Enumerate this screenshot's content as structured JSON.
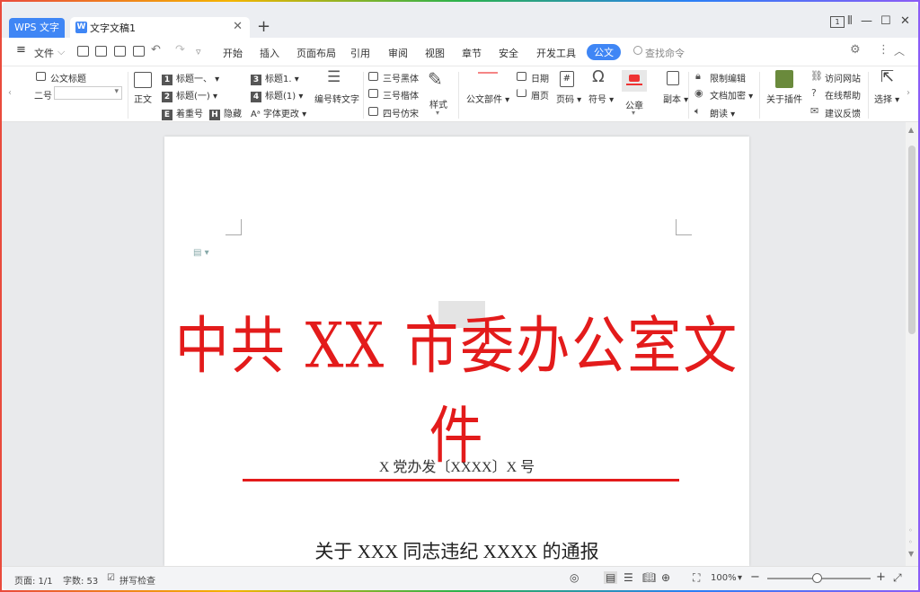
{
  "titlebar": {
    "app_tab": "WPS 文字",
    "doc_tab": "文字文稿1",
    "new_tab": "+",
    "badge": "1"
  },
  "menubar": {
    "file": "文件",
    "tabs": [
      "开始",
      "插入",
      "页面布局",
      "引用",
      "审阅",
      "视图",
      "章节",
      "安全",
      "开发工具",
      "公文"
    ],
    "active_tab": "公文",
    "search_placeholder": "查找命令"
  },
  "ribbon": {
    "official_title": "公文标题",
    "size_label": "二号",
    "body_text": "正文",
    "heading1": "标题一、",
    "heading2": "标题(一)",
    "emphasis": "着重号",
    "hide": "隐藏",
    "heading3": "标题1.",
    "heading4": "标题(1)",
    "font_change": "字体更改",
    "num_to_text": "编号转文字",
    "font_hei": "三号黑体",
    "font_kai": "三号楷体",
    "font_fang": "四号仿宋",
    "style": "样式",
    "doc_parts": "公文部件",
    "date": "日期",
    "header": "眉页",
    "page_num": "页码",
    "symbol": "符号",
    "seal": "公章",
    "copy": "副本",
    "restrict_edit": "限制编辑",
    "doc_encrypt": "文档加密",
    "read_aloud": "朗读",
    "about_plugin": "关于插件",
    "visit_site": "访问网站",
    "online_help": "在线帮助",
    "feedback": "建议反馈",
    "select": "选择"
  },
  "document": {
    "title": "中共 XX 市委办公室文件",
    "number": "X 党办发〔XXXX〕X 号",
    "subject": "关于 XXX 同志违纪 XXXX 的通报"
  },
  "statusbar": {
    "page": "页面: 1/1",
    "words": "字数: 53",
    "spellcheck": "拼写检查",
    "zoom": "100%"
  },
  "colors": {
    "accent": "#3f86f5",
    "red_header": "#e31b1b"
  }
}
